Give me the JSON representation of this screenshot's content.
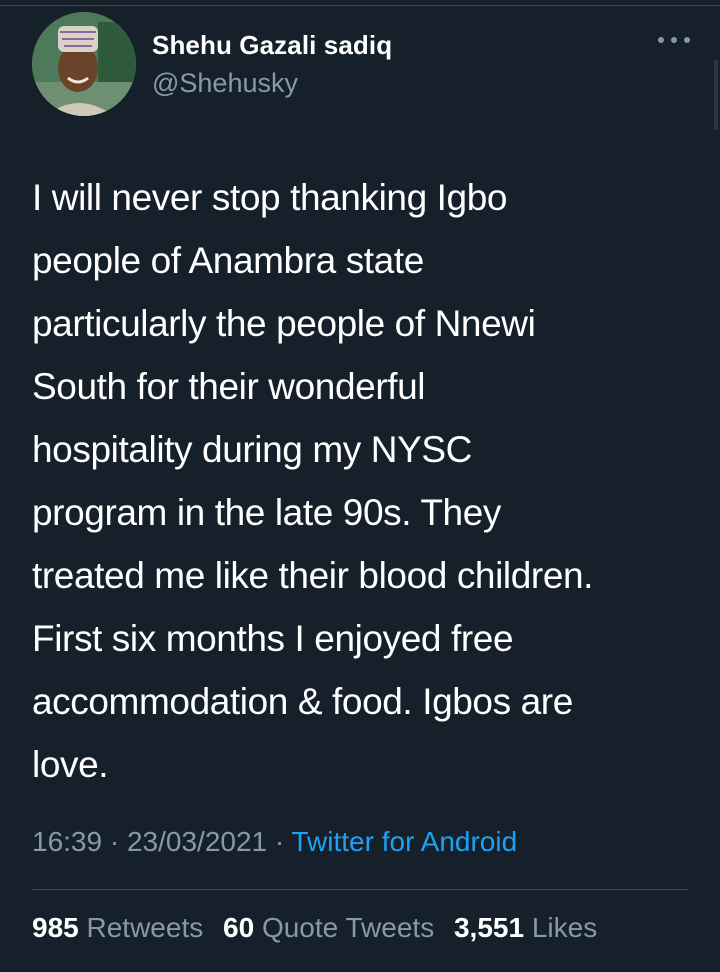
{
  "tweet": {
    "author": {
      "name": "Shehu Gazali sadiq",
      "handle": "@Shehusky"
    },
    "text": "I will never stop thanking Igbo\npeople of Anambra state\nparticularly the people of Nnewi\nSouth for their wonderful\nhospitality during my NYSC\nprogram in the late 90s. They\ntreated me like their blood children.\nFirst six months I enjoyed free\naccommodation & food.  Igbos are\nlove.",
    "time": "16:39",
    "date": "23/03/2021",
    "separator": "·",
    "source": "Twitter for Android",
    "stats": {
      "retweets_count": "985",
      "retweets_label": "Retweets",
      "quotes_count": "60",
      "quotes_label": "Quote Tweets",
      "likes_count": "3,551",
      "likes_label": "Likes"
    }
  },
  "colors": {
    "background": "#15202b",
    "secondary_text": "#8899a6",
    "link": "#1da1f2",
    "divider": "#38444d"
  },
  "icons": [
    "more-icon"
  ]
}
